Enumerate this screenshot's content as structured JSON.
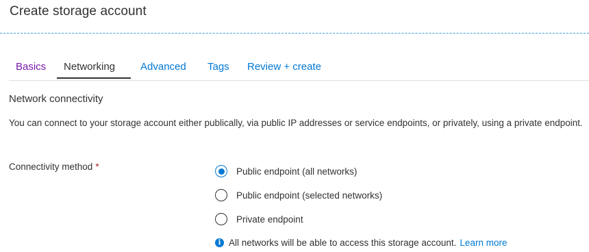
{
  "page": {
    "title": "Create storage account"
  },
  "tabs": [
    {
      "label": "Basics",
      "state": "visited"
    },
    {
      "label": "Networking",
      "state": "active"
    },
    {
      "label": "Advanced",
      "state": "link"
    },
    {
      "label": "Tags",
      "state": "link"
    },
    {
      "label": "Review + create",
      "state": "link"
    }
  ],
  "section": {
    "heading": "Network connectivity",
    "description": "You can connect to your storage account either publically, via public IP addresses or service endpoints, or privately, using a private endpoint."
  },
  "connectivity": {
    "label": "Connectivity method",
    "required_mark": "*",
    "options": [
      {
        "label": "Public endpoint (all networks)",
        "selected": true
      },
      {
        "label": "Public endpoint (selected networks)",
        "selected": false
      },
      {
        "label": "Private endpoint",
        "selected": false
      }
    ],
    "info": {
      "icon": "info-icon",
      "glyph": "i",
      "text": "All networks will be able to access this storage account.",
      "link_label": "Learn more"
    }
  },
  "colors": {
    "accent": "#0078d4",
    "visited_link": "#7719aa",
    "required": "#a4262c",
    "divider": "#3aa0d8"
  }
}
